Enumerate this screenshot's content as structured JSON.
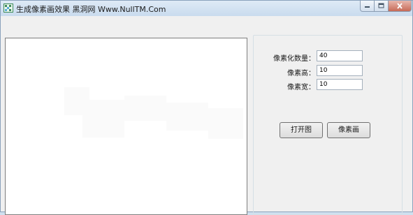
{
  "window": {
    "title": "生成像素画效果 黑洞网 Www.NullTM.Com"
  },
  "settings": {
    "pixel_count_label": "像素化数量：",
    "pixel_count_value": "40",
    "pixel_height_label": "像素高：",
    "pixel_height_value": "10",
    "pixel_width_label": "像素宽：",
    "pixel_width_value": "10"
  },
  "buttons": {
    "open_image": "打开图",
    "pixelate": "像素画"
  },
  "icons": {
    "app": "app-icon",
    "minimize": "minimize-icon",
    "maximize": "maximize-icon",
    "close": "close-icon"
  }
}
